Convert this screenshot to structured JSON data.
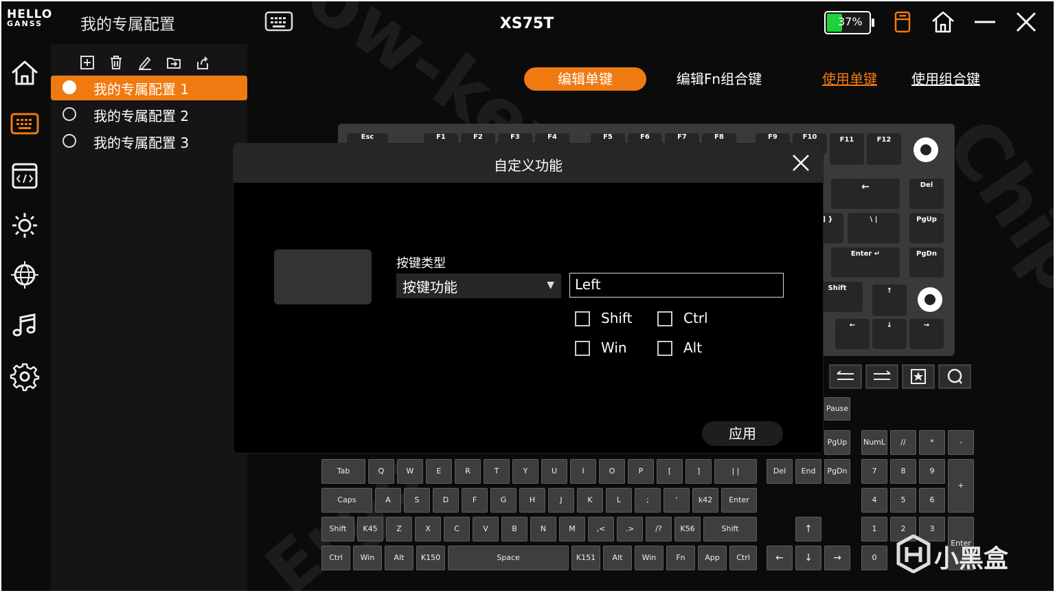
{
  "app": {
    "logo_line1": "HELLO",
    "logo_line2": "GANSS",
    "profile_name": "我的专属配置",
    "device_title": "XS75T",
    "battery_text": "37%",
    "battery_level": 0.37
  },
  "icons": {
    "keyboard_top": "keyboard-icon",
    "battery": "battery-icon",
    "device": "device-icon",
    "home": "home-icon",
    "minimize": "minimize-icon",
    "close": "close-icon"
  },
  "sidebar": {
    "items": [
      "home-icon",
      "keyboard-icon",
      "macro-icon",
      "lighting-icon",
      "network-icon",
      "music-icon",
      "settings-icon"
    ]
  },
  "profiles": {
    "tools": [
      "add-icon",
      "delete-icon",
      "rename-icon",
      "import-icon",
      "export-icon"
    ],
    "items": [
      {
        "label": "我的专属配置 1",
        "active": true
      },
      {
        "label": "我的专属配置 2",
        "active": false
      },
      {
        "label": "我的专属配置 3",
        "active": false
      }
    ]
  },
  "tabs": {
    "edit_single": "编辑单键",
    "edit_fn": "编辑Fn组合键",
    "use_single": "使用单键",
    "use_combo": "使用组合键"
  },
  "keyboard_top_keys": [
    "Esc",
    "F1",
    "F2",
    "F3",
    "F4",
    "F5",
    "F6",
    "F7",
    "F8",
    "F9",
    "F10",
    "F11",
    "F12"
  ],
  "keyboard_right_keys": {
    "backspace": "←",
    "del": "Del",
    "bracket": "] }",
    "backslash": "\\ |",
    "pgup": "PgUp",
    "enter": "Enter ↵",
    "pgdn": "PgDn",
    "shift": "Shift",
    "up": "↑",
    "left": "←",
    "down": "↓",
    "right": "→"
  },
  "media_keys": [
    "backward-icon",
    "forward-icon",
    "star-icon",
    "search-icon"
  ],
  "grid_keys": {
    "pause": "Pause",
    "row_tab": [
      "Tab",
      "Q",
      "W",
      "E",
      "R",
      "T",
      "Y",
      "U",
      "I",
      "O",
      "P",
      "[",
      "]",
      "| |"
    ],
    "row_caps": [
      "Caps",
      "A",
      "S",
      "D",
      "F",
      "G",
      "H",
      "J",
      "K",
      "L",
      ";",
      "'",
      "k42",
      "Enter"
    ],
    "row_shift": [
      "Shift",
      "K45",
      "Z",
      "X",
      "C",
      "V",
      "B",
      "N",
      "M",
      ",<",
      ".>",
      "/?",
      "K56",
      "Shift"
    ],
    "row_ctrl": [
      "Ctrl",
      "Win",
      "Alt",
      "K150",
      "Space",
      "K151",
      "Alt",
      "Win",
      "Fn",
      "App",
      "Ctrl"
    ],
    "nav_top": [
      "PgUp"
    ],
    "nav_row": [
      "Del",
      "End",
      "PgDn"
    ],
    "arrows": [
      "↑",
      "←",
      "↓",
      "→"
    ],
    "numpad_row1": [
      "NumL",
      "//",
      "*",
      "-"
    ],
    "numpad_row2": [
      "7",
      "8",
      "9"
    ],
    "numpad_row3": [
      "4",
      "5",
      "6"
    ],
    "numpad_row4": [
      "1",
      "2",
      "3"
    ],
    "numpad_row5": [
      "0"
    ],
    "numpad_plus": "+",
    "numpad_enter": "Enter"
  },
  "modal": {
    "title": "自定义功能",
    "keytype_label": "按键类型",
    "keytype_value": "按键功能",
    "value": "Left",
    "modifiers": [
      {
        "label": "Shift",
        "checked": false
      },
      {
        "label": "Ctrl",
        "checked": false
      },
      {
        "label": "Win",
        "checked": false
      },
      {
        "label": "Alt",
        "checked": false
      }
    ],
    "apply": "应用"
  },
  "watermark": "小黑盒"
}
